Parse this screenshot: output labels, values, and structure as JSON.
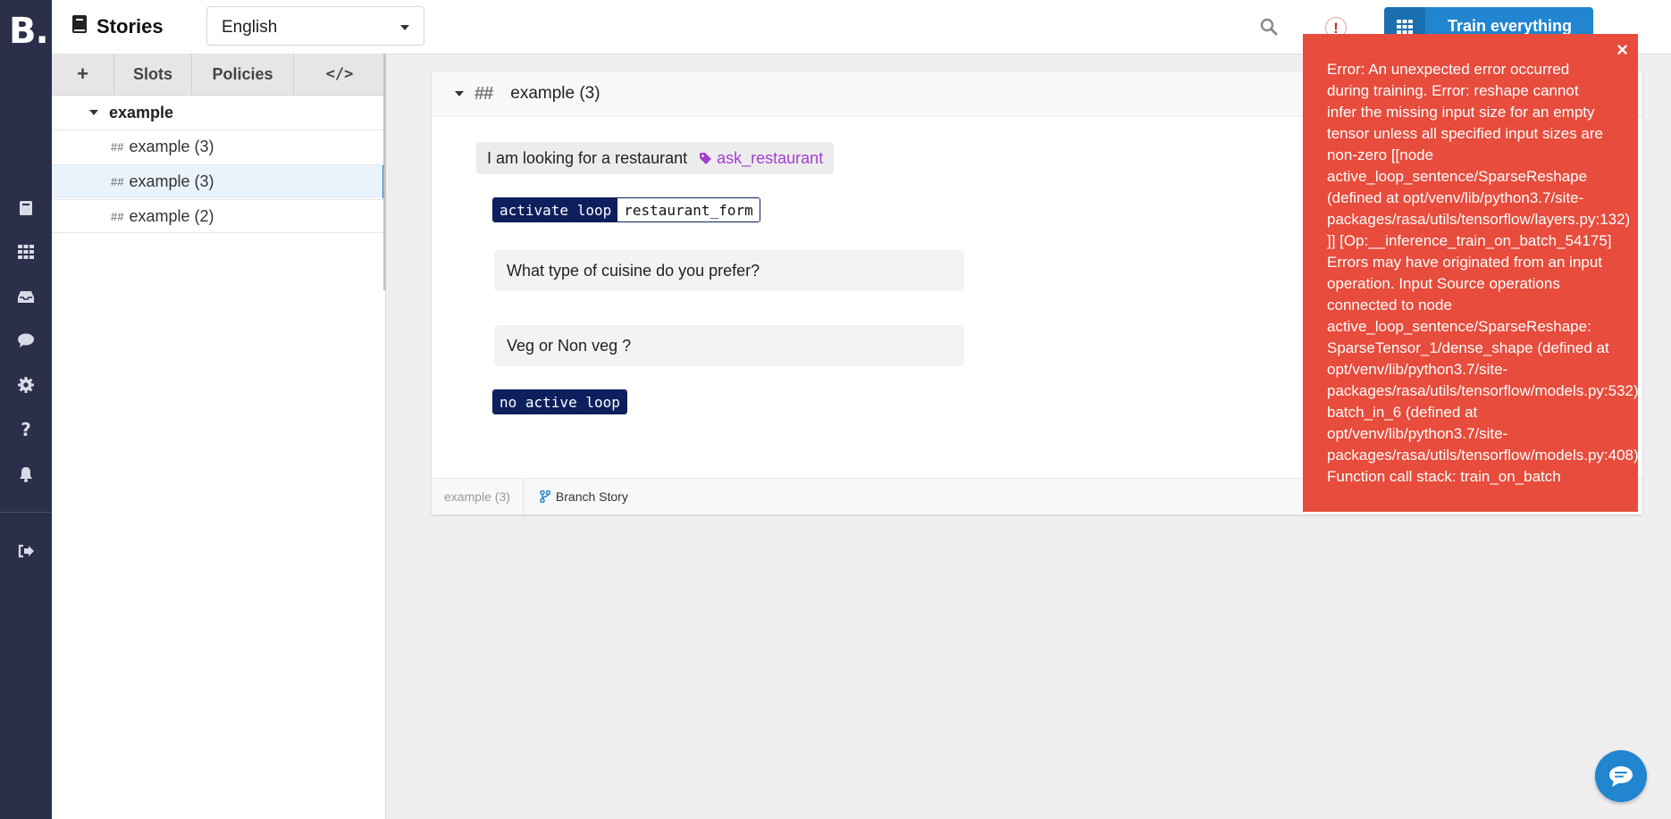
{
  "app": {
    "logo": "B."
  },
  "header": {
    "title": "Stories",
    "language": "English",
    "train_label": "Train everything",
    "alert_glyph": "!"
  },
  "rail": {
    "icons": [
      "book-icon",
      "grid-icon",
      "inbox-icon",
      "chat-bubble-icon",
      "gear-icon",
      "help-icon",
      "bell-icon",
      "logout-icon"
    ]
  },
  "sidebar": {
    "tabs": [
      {
        "label": "+"
      },
      {
        "label": "Slots"
      },
      {
        "label": "Policies"
      },
      {
        "label": "</>"
      }
    ],
    "group": "example",
    "stories": [
      {
        "label": "example (3)",
        "active": false
      },
      {
        "label": "example (3)",
        "active": true
      },
      {
        "label": "example (2)",
        "active": false
      }
    ],
    "hash_glyph": "##"
  },
  "story": {
    "hash_glyph": "##",
    "title": "example (3)",
    "user_utterance": "I am looking for a restaurant",
    "intent": "ask_restaurant",
    "activate_loop_key": "activate loop",
    "activate_loop_value": "restaurant_form",
    "bot_responses": [
      "What type of cuisine do you prefer?",
      "Veg or Non veg ?"
    ],
    "no_active_loop": "no active loop",
    "footer_crumb": "example (3)",
    "branch_label": "Branch Story"
  },
  "error": {
    "close_glyph": "×",
    "lines": [
      "Error: An unexpected error occurred",
      "during training. Error: reshape cannot",
      "infer the missing input size for an empty",
      "tensor unless all specified input sizes are",
      "non-zero [[node",
      "active_loop_sentence/SparseReshape",
      "(defined at opt/venv/lib/python3.7/site-",
      "packages/rasa/utils/tensorflow/layers.py:132)",
      "]] [Op:__inference_train_on_batch_54175]",
      "Errors may have originated from an input",
      "operation. Input Source operations",
      "connected to node",
      "active_loop_sentence/SparseReshape:",
      "SparseTensor_1/dense_shape (defined at",
      "opt/venv/lib/python3.7/site-",
      "packages/rasa/utils/tensorflow/models.py:532)",
      "batch_in_6 (defined at",
      "opt/venv/lib/python3.7/site-",
      "packages/rasa/utils/tensorflow/models.py:408)",
      "Function call stack: train_on_batch"
    ]
  },
  "colors": {
    "rail_bg": "#2b2f49",
    "accent": "#2185d0",
    "error_bg": "#e74c3c",
    "intent": "#a33fd0",
    "loop_bg": "#0d1f5c"
  }
}
